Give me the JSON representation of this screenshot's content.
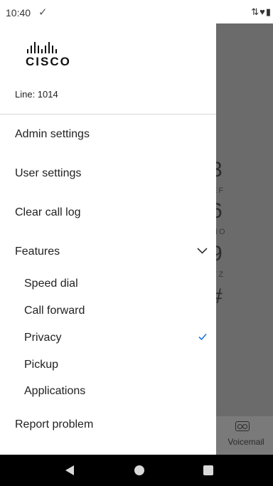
{
  "status_bar": {
    "time": "10:40",
    "check_glyph": "✓",
    "icons_glyph": "⇅♥▮"
  },
  "drawer": {
    "logo_text": "CISCO",
    "line_label": "Line: 1014",
    "menu": {
      "admin_settings": "Admin settings",
      "user_settings": "User settings",
      "clear_call_log": "Clear call log",
      "features": "Features",
      "report_problem": "Report problem"
    },
    "features_sub": {
      "speed_dial": "Speed dial",
      "call_forward": "Call forward",
      "privacy": "Privacy",
      "pickup": "Pickup",
      "applications": "Applications"
    },
    "privacy_checked": true,
    "accent_color": "#1a73e8"
  },
  "background_dialer": {
    "digits": [
      "3",
      "6",
      "9",
      "#"
    ],
    "letters": [
      "EF",
      "NO",
      "YZ"
    ],
    "voicemail_label": "Voicemail"
  },
  "nav_bar": {
    "icons": [
      "back-icon",
      "home-icon",
      "recents-icon"
    ]
  }
}
